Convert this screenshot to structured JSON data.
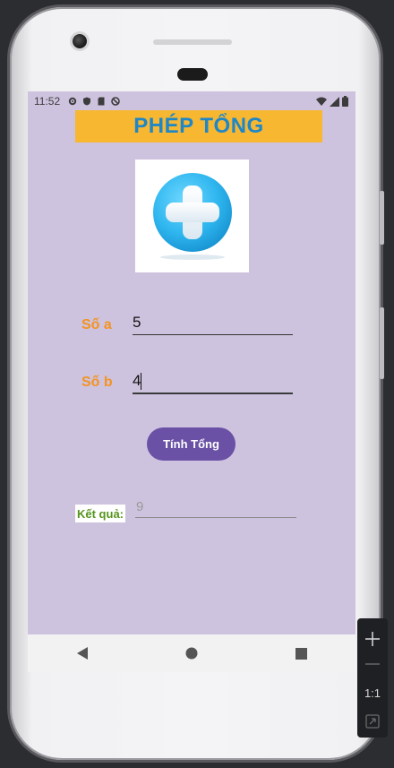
{
  "status_bar": {
    "time": "11:52",
    "left_icons": [
      "gear-icon",
      "shield-icon",
      "sd-card-icon",
      "no-sync-icon"
    ],
    "right_icons": [
      "wifi-icon",
      "signal-icon",
      "battery-icon"
    ]
  },
  "app": {
    "title": "PHÉP TỔNG",
    "image_icon": "plus-circle-icon",
    "field_a": {
      "label": "Số a",
      "value": "5"
    },
    "field_b": {
      "label": "Số b",
      "value": "4"
    },
    "button_label": "Tính Tổng",
    "result": {
      "label": "Kết quả:",
      "value": "9"
    }
  },
  "nav_bar": {
    "buttons": [
      "back-icon",
      "home-icon",
      "recents-icon"
    ]
  },
  "emulator_toolbar": {
    "items": [
      "zoom-in-icon",
      "zoom-out-icon",
      "one-to-one",
      "fit-screen-icon"
    ],
    "one_to_one_label": "1:1"
  },
  "colors": {
    "screen_background": "#cec3de",
    "title_background": "#f7b731",
    "title_text": "#1f87c7",
    "label_orange": "#f39322",
    "button": "#6a51a6",
    "result_label_text": "#55941c"
  }
}
